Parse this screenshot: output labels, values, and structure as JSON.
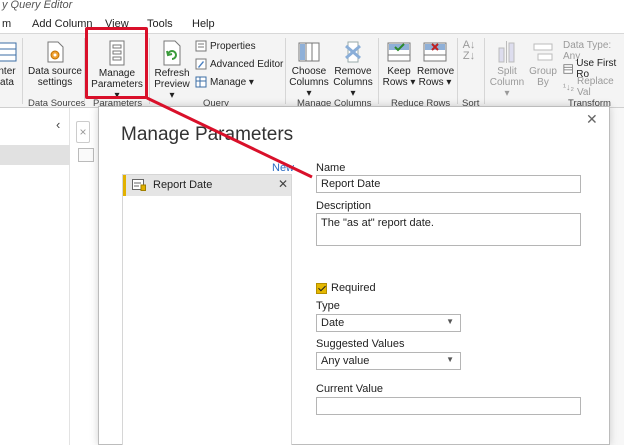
{
  "window": {
    "title": "y Query Editor"
  },
  "menu": {
    "tabs": [
      "m",
      "Add Column",
      "View",
      "Tools",
      "Help"
    ]
  },
  "ribbon": {
    "enter_data": {
      "line1": "nter",
      "line2": "ata"
    },
    "data_source_settings": {
      "line1": "Data source",
      "line2": "settings"
    },
    "data_sources_label": "Data Sources",
    "manage_parameters": {
      "line1": "Manage",
      "line2": "Parameters ▾"
    },
    "parameters_label": "Parameters",
    "refresh_preview": {
      "line1": "Refresh",
      "line2": "Preview ▾"
    },
    "properties": "Properties",
    "advanced_editor": "Advanced Editor",
    "manage": "Manage ▾",
    "query_label": "Query",
    "choose_columns": {
      "line1": "Choose",
      "line2": "Columns ▾"
    },
    "remove_columns": {
      "line1": "Remove",
      "line2": "Columns ▾"
    },
    "manage_columns_label": "Manage Columns",
    "keep_rows": {
      "line1": "Keep",
      "line2": "Rows ▾"
    },
    "remove_rows": {
      "line1": "Remove",
      "line2": "Rows ▾"
    },
    "reduce_rows_label": "Reduce Rows",
    "sort_label": "Sort",
    "split_column": {
      "line1": "Split",
      "line2": "Column ▾"
    },
    "group_by": {
      "line1": "Group",
      "line2": "By"
    },
    "data_type": "Data Type: Any",
    "use_first_row": "Use First Ro",
    "replace_values": "Replace Val",
    "transform_label": "Transform"
  },
  "dialog": {
    "title": "Manage Parameters",
    "new_label": "New",
    "parameters": [
      {
        "name": "Report Date"
      }
    ],
    "name_label": "Name",
    "name_value": "Report Date",
    "description_label": "Description",
    "description_value": "The \"as at\" report date.",
    "required_label": "Required",
    "type_label": "Type",
    "type_value": "Date",
    "suggested_label": "Suggested Values",
    "suggested_value": "Any value",
    "current_label": "Current Value",
    "current_value": ""
  },
  "colors": {
    "highlight": "#d9102a",
    "accent": "#e2b100",
    "link": "#2b6cc4"
  }
}
